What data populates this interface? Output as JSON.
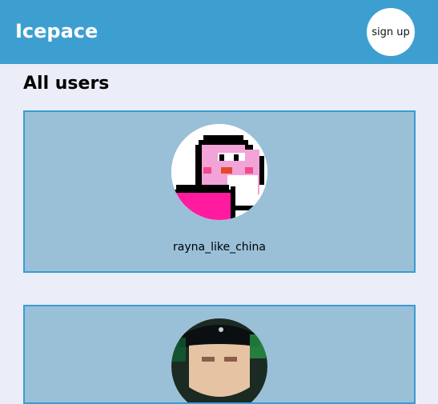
{
  "header": {
    "brand": "Icepace",
    "signup_label": "sign up"
  },
  "main": {
    "title": "All users",
    "users": [
      {
        "username": "rayna_like_china",
        "avatar": "pixel-penguin-avatar"
      },
      {
        "username": "",
        "avatar": "photo-avatar"
      }
    ]
  }
}
